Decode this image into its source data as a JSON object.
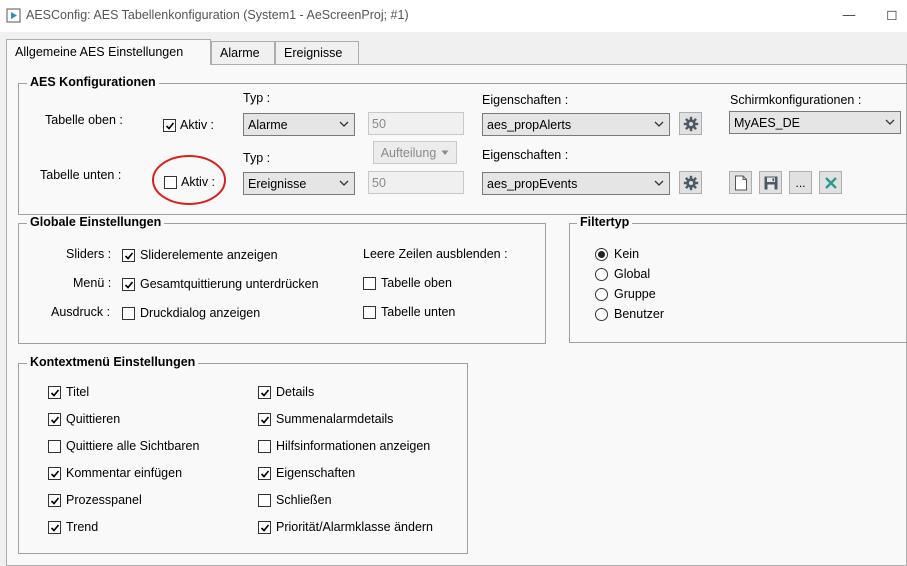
{
  "window": {
    "title": "AESConfig: AES Tabellenkonfiguration (System1 - AeScreenProj; #1)",
    "minimize_glyph": "—",
    "maximize_glyph": "☐"
  },
  "tabs": [
    {
      "label": "Allgemeine AES Einstellungen",
      "active": true
    },
    {
      "label": "Alarme",
      "active": false
    },
    {
      "label": "Ereignisse",
      "active": false
    }
  ],
  "aes_config": {
    "title": "AES Konfigurationen",
    "top": {
      "label": "Tabelle oben :",
      "active_label": "Aktiv :",
      "active_checked": true,
      "typ_label": "Typ :",
      "typ_value": "Alarme",
      "number_value": "50",
      "eigenschaften_label": "Eigenschaften :",
      "eigenschaften_value": "aes_propAlerts",
      "schirm_label": "Schirmkonfigurationen :",
      "schirm_value": "MyAES_DE"
    },
    "bottom": {
      "label": "Tabelle unten :",
      "active_label": "Aktiv :",
      "active_checked": false,
      "typ_label": "Typ :",
      "typ_value": "Ereignisse",
      "number_value": "50",
      "split_button_label": "Aufteilung",
      "eigenschaften_label": "Eigenschaften :",
      "eigenschaften_value": "aes_propEvents",
      "more_button_label": "..."
    }
  },
  "global": {
    "title": "Globale Einstellungen",
    "rows": [
      {
        "label": "Sliders :",
        "check_label": "Sliderelemente anzeigen",
        "checked": true
      },
      {
        "label": "Menü :",
        "check_label": "Gesamtquittierung unterdrücken",
        "checked": true
      },
      {
        "label": "Ausdruck :",
        "check_label": "Druckdialog anzeigen",
        "checked": false
      }
    ],
    "empty_rows_label": "Leere Zeilen ausblenden :",
    "empty_rows": [
      {
        "label": "Tabelle oben",
        "checked": false
      },
      {
        "label": "Tabelle unten",
        "checked": false
      }
    ]
  },
  "filter": {
    "title": "Filtertyp",
    "options": [
      {
        "label": "Kein",
        "selected": true
      },
      {
        "label": "Global",
        "selected": false
      },
      {
        "label": "Gruppe",
        "selected": false
      },
      {
        "label": "Benutzer",
        "selected": false
      }
    ]
  },
  "context": {
    "title": "Kontextmenü Einstellungen",
    "left": [
      {
        "label": "Titel",
        "checked": true
      },
      {
        "label": "Quittieren",
        "checked": true
      },
      {
        "label": "Quittiere alle Sichtbaren",
        "checked": false
      },
      {
        "label": "Kommentar einfügen",
        "checked": true
      },
      {
        "label": "Prozesspanel",
        "checked": true
      },
      {
        "label": "Trend",
        "checked": true
      }
    ],
    "right": [
      {
        "label": "Details",
        "checked": true
      },
      {
        "label": "Summenalarmdetails",
        "checked": true
      },
      {
        "label": "Hilfsinformationen anzeigen",
        "checked": false
      },
      {
        "label": "Eigenschaften",
        "checked": true
      },
      {
        "label": "Schließen",
        "checked": false
      },
      {
        "label": "Priorität/Alarmklasse ändern",
        "checked": true
      }
    ]
  },
  "annotation": {
    "color": "#d9201e"
  }
}
